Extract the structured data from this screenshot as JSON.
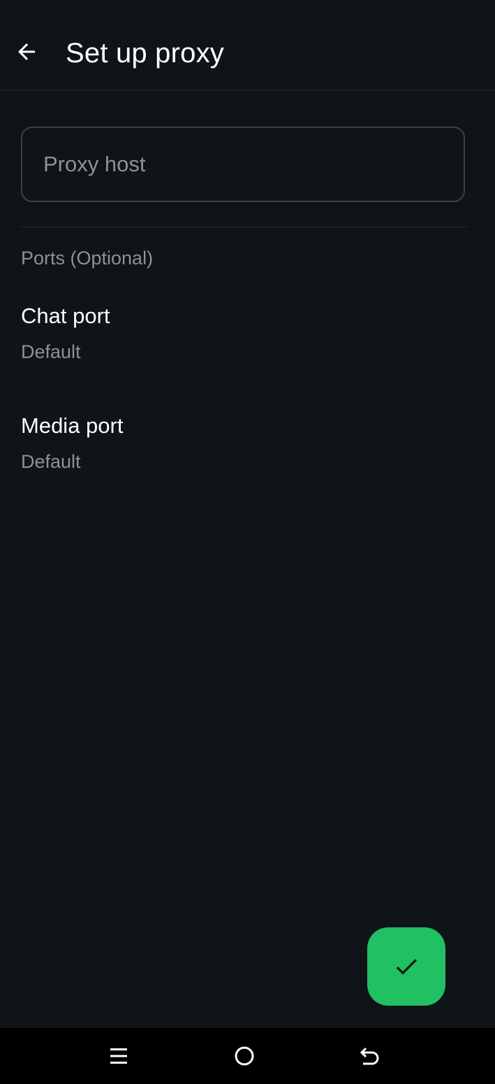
{
  "header": {
    "title": "Set up proxy",
    "back_icon": "arrow-left-icon"
  },
  "proxy_host": {
    "placeholder": "Proxy host",
    "value": ""
  },
  "ports_section": {
    "label": "Ports (Optional)",
    "items": [
      {
        "label": "Chat port",
        "value": "Default"
      },
      {
        "label": "Media port",
        "value": "Default"
      }
    ]
  },
  "fab": {
    "icon": "check-icon",
    "color": "#21c063"
  },
  "system_nav": {
    "icons": [
      "menu-icon",
      "home-icon",
      "back-icon"
    ]
  },
  "colors": {
    "background": "#0f1418",
    "accent": "#21c063",
    "secondary_text": "#8a9399"
  }
}
